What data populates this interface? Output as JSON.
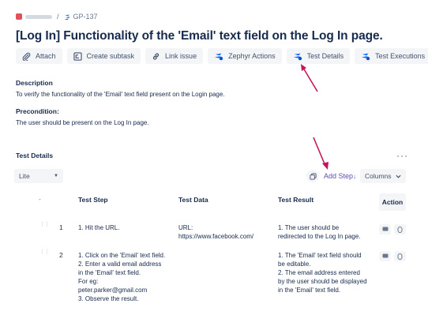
{
  "breadcrumb": {
    "separator": "/",
    "issue_key": "GP-137"
  },
  "title": "[Log In] Functionality of the 'Email' text field on the Log In page.",
  "toolbar": {
    "attach": "Attach",
    "create_subtask": "Create subtask",
    "link_issue": "Link issue",
    "zephyr_actions": "Zephyr Actions",
    "test_details": "Test Details",
    "test_executions": "Test Executions"
  },
  "description": {
    "heading": "Description",
    "text": "To verify the functionality of the 'Email' text field present on the Login page."
  },
  "precondition": {
    "heading": "Precondition:",
    "text": "The user should be present on the Log In page."
  },
  "test_details": {
    "heading": "Test Details",
    "more": "···",
    "view_mode": "Lite",
    "add_step": "Add Step",
    "columns": "Columns",
    "accent_color": "#5e4db2",
    "annotation_color": "#c2185b"
  },
  "table": {
    "headers": {
      "index": "-",
      "step": "Test Step",
      "data": "Test Data",
      "result": "Test Result",
      "action": "Action"
    },
    "rows": [
      {
        "num": "1",
        "step": [
          "1. Hit the URL."
        ],
        "data": [
          "URL:",
          "https://www.facebook.com/"
        ],
        "result": [
          "1. The user should be",
          "redirected to the Log In page."
        ]
      },
      {
        "num": "2",
        "step": [
          "1. Click on the 'Email' text field.",
          "2. Enter a valid email address",
          "in the 'Email' text field.",
          "For eg:",
          "peter.parker@gmail.com",
          "3. Observe the result."
        ],
        "data": [],
        "result": [
          "1. The 'Email' text field should",
          "be editable.",
          "2. The email address entered",
          "by the user should be displayed",
          "in the 'Email' text field."
        ]
      }
    ]
  }
}
